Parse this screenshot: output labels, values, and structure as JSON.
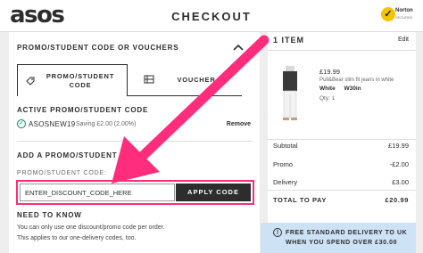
{
  "header": {
    "logo": "asos",
    "title": "CHECKOUT",
    "norton_text": "Norton",
    "norton_sub": "SECURED"
  },
  "promo": {
    "section_title": "PROMO/STUDENT CODE OR VOUCHERS",
    "tab_student": "PROMO/STUDENT CODE",
    "tab_voucher": "VOUCHER",
    "active_title": "ACTIVE PROMO/STUDENT CODE",
    "active_code": "ASOSNEW19",
    "active_saving": "Saving £2.00 (2.00%)",
    "remove_label": "Remove",
    "add_title": "ADD A PROMO/STUDENT CODE",
    "field_label": "PROMO/STUDENT CODE:",
    "input_value": "ENTER_DISCOUNT_CODE_HERE",
    "apply_label": "APPLY CODE",
    "need_title": "NEED TO KNOW",
    "note_1": "You can only use one discount/promo code per order.",
    "note_2": "This applies to our one-delivery codes, too."
  },
  "bag": {
    "item_count": "1 ITEM",
    "edit_label": "Edit",
    "price": "£19.99",
    "description": "Pull&Bear slim fit jeans in white",
    "color": "White",
    "size": "W30in",
    "qty": "Qty: 1"
  },
  "totals": {
    "subtotal_label": "Subtotal",
    "subtotal_value": "£19.99",
    "promo_label": "Promo",
    "promo_value": "-£2.00",
    "delivery_label": "Delivery",
    "delivery_value": "£3.00",
    "total_label": "TOTAL TO PAY",
    "total_value": "£20.99"
  },
  "banner": {
    "line1": "FREE STANDARD DELIVERY TO UK",
    "line2": "WHEN YOU SPEND OVER £30.00"
  },
  "colors": {
    "accent": "#ff2d7b",
    "dark": "#2d2d2d",
    "success": "#018849",
    "banner": "#cde2f5"
  }
}
